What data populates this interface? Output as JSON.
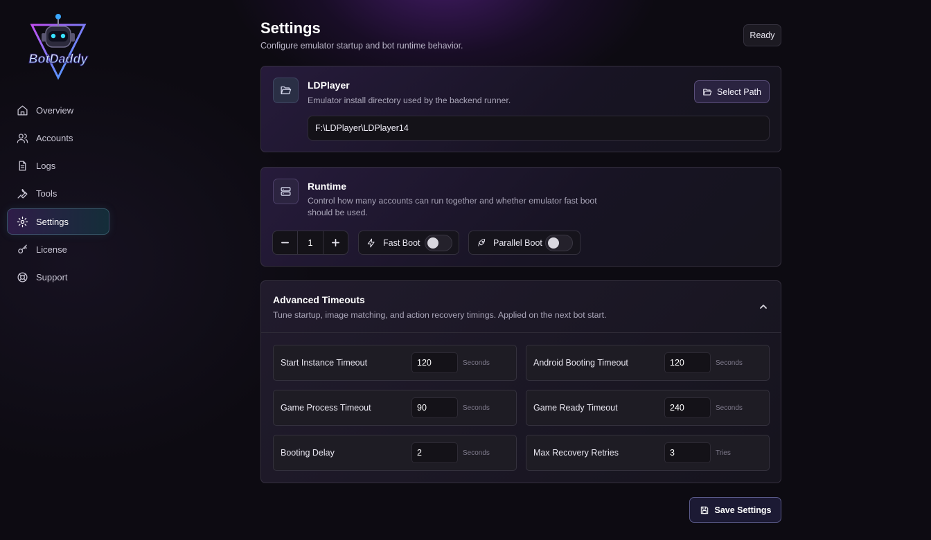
{
  "app": {
    "logo_text": "BotDaddy"
  },
  "sidebar": {
    "items": [
      {
        "label": "Overview",
        "icon": "home-icon"
      },
      {
        "label": "Accounts",
        "icon": "users-icon"
      },
      {
        "label": "Logs",
        "icon": "file-text-icon"
      },
      {
        "label": "Tools",
        "icon": "wrench-icon"
      },
      {
        "label": "Settings",
        "icon": "gear-icon",
        "active": true
      },
      {
        "label": "License",
        "icon": "key-icon"
      },
      {
        "label": "Support",
        "icon": "lifebuoy-icon"
      }
    ]
  },
  "header": {
    "title": "Settings",
    "subtitle": "Configure emulator startup and bot runtime behavior.",
    "status": "Ready"
  },
  "ldplayer": {
    "title": "LDPlayer",
    "description": "Emulator install directory used by the backend runner.",
    "select_path_label": "Select Path",
    "path_value": "F:\\LDPlayer\\LDPlayer14"
  },
  "runtime": {
    "title": "Runtime",
    "description_line1": "Control how many accounts can run together and whether emulator fast boot",
    "description_line2": "should be used.",
    "instance_count": "1",
    "fast_boot": {
      "label": "Fast Boot",
      "enabled": false
    },
    "parallel_boot": {
      "label": "Parallel Boot",
      "enabled": false
    }
  },
  "advanced": {
    "title": "Advanced Timeouts",
    "description": "Tune startup, image matching, and action recovery timings. Applied on the next bot start.",
    "expanded": true,
    "fields": [
      {
        "label": "Start Instance Timeout",
        "value": "120",
        "unit": "Seconds"
      },
      {
        "label": "Android Booting Timeout",
        "value": "120",
        "unit": "Seconds"
      },
      {
        "label": "Game Process Timeout",
        "value": "90",
        "unit": "Seconds"
      },
      {
        "label": "Game Ready Timeout",
        "value": "240",
        "unit": "Seconds"
      },
      {
        "label": "Booting Delay",
        "value": "2",
        "unit": "Seconds"
      },
      {
        "label": "Max Recovery Retries",
        "value": "3",
        "unit": "Tries"
      }
    ]
  },
  "footer": {
    "save_label": "Save Settings"
  },
  "colors": {
    "accent": "#5a4e7a",
    "active_nav": "#2b4a58",
    "background": "#0d0b12"
  }
}
